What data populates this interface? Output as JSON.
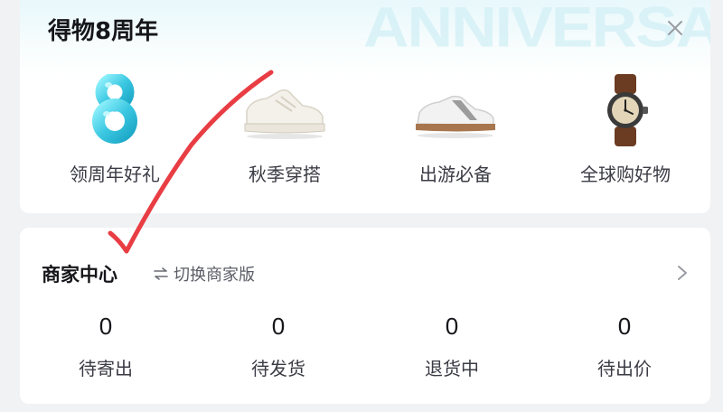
{
  "anniversary": {
    "title": "得物8周年",
    "watermark": "ANNIVERSARY",
    "features": [
      {
        "label": "领周年好礼",
        "icon": "balloon-8-icon"
      },
      {
        "label": "秋季穿搭",
        "icon": "white-sneaker-icon"
      },
      {
        "label": "出游必备",
        "icon": "grey-sneaker-icon"
      },
      {
        "label": "全球购好物",
        "icon": "wristwatch-icon"
      }
    ]
  },
  "merchant": {
    "title": "商家中心",
    "switch_label": "切换商家版",
    "stats": [
      {
        "count": "0",
        "label": "待寄出"
      },
      {
        "count": "0",
        "label": "待发货"
      },
      {
        "count": "0",
        "label": "退货中"
      },
      {
        "count": "0",
        "label": "待出价"
      }
    ]
  },
  "colors": {
    "accent_cyan": "#4fd1e8",
    "annotation_red": "#e8333a"
  }
}
